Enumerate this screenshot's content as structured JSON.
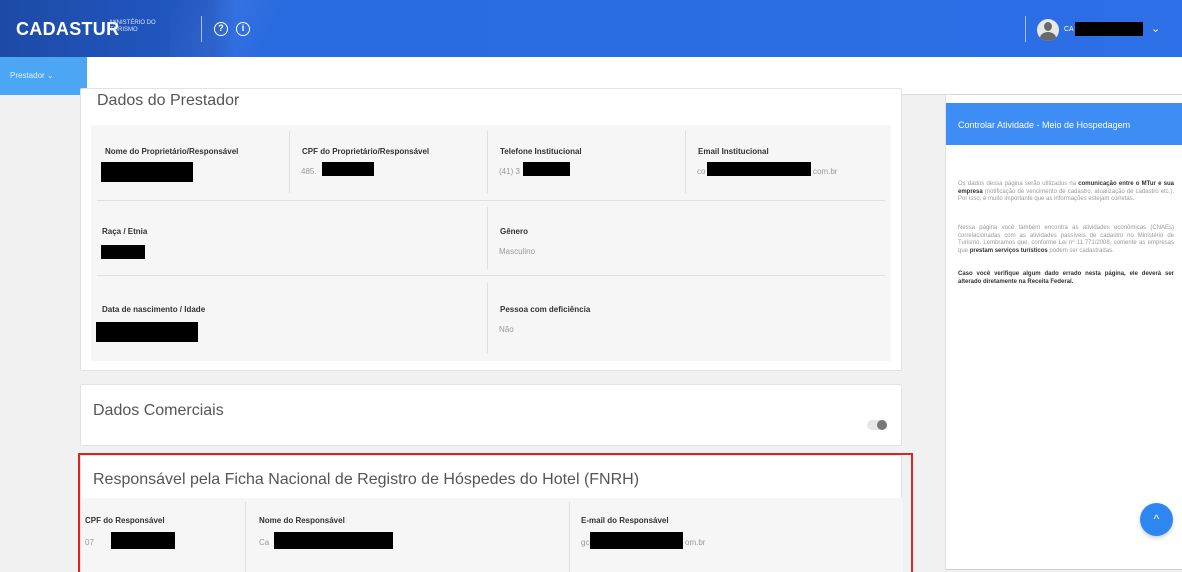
{
  "header": {
    "brand": "CADASTUR",
    "brand_sub": "MINISTÉRIO DO TURISMO",
    "help_icon": "?",
    "info_icon": "i",
    "user_initials": "CA",
    "chevron": "⌄"
  },
  "subnav": {
    "menu_label": "Prestador ⌄"
  },
  "prestador": {
    "title": "Dados do Prestador",
    "fields": {
      "nome_label": "Nome do Proprietário/Responsável",
      "cpf_label": "CPF do Proprietário/Responsável",
      "cpf_value": "485.",
      "tel_label": "Telefone Institucional",
      "tel_value": "(41) 3",
      "email_label": "Email Institucional",
      "email_value_prefix": "co",
      "email_value_suffix": "com.br",
      "raca_label": "Raça / Etnia",
      "genero_label": "Gênero",
      "genero_value": "Masculino",
      "nascimento_label": "Data de nascimento / Idade",
      "deficiencia_label": "Pessoa com deficiência",
      "deficiencia_value": "Não"
    }
  },
  "comerciais": {
    "title": "Dados Comerciais"
  },
  "fnrh": {
    "title": "Responsável pela Ficha Nacional de Registro de Hóspedes do Hotel (FNRH)",
    "cpf_label": "CPF do Responsável",
    "cpf_value": "07",
    "nome_label": "Nome do Responsável",
    "nome_value": "Ca",
    "email_label": "E-mail do Responsável",
    "email_value_prefix": "gc",
    "email_value_suffix": "om.br"
  },
  "side_panel": {
    "title": "Controlar Atividade - Meio de Hospedagem",
    "p1_a": "Os dados dessa página serão utilizados na ",
    "p1_b": "comunicação entre o MTur e sua empresa",
    "p1_c": " (notificação de vencimento de cadastro, atualização de cadastro etc.). Por isso, é muito importante que as informações estejam corretas.",
    "p2_a": "Nessa página você também encontra as atividades econômicas (CNAEs) correlacionadas com as atividades passíveis de cadastro no Ministério de Turismo. Lembramos que, conforme Lei nº 11.771/2008, somente as empresas que ",
    "p2_b": "prestam serviços turísticos",
    "p2_c": " podem ser cadastradas.",
    "p3": "Caso você verifique algum dado errado nesta página, ele deverá ser alterado diretamente na Receita Federal."
  },
  "fab_icon": "^"
}
